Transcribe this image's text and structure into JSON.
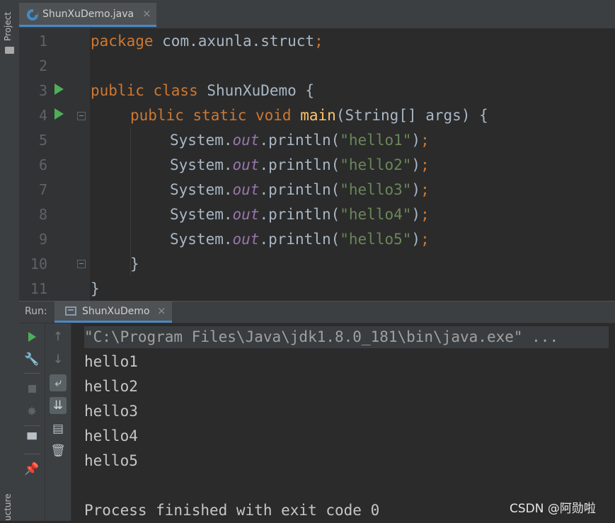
{
  "sidebar": {
    "project_label": "Project",
    "structure_label": "ucture"
  },
  "editor": {
    "tab_label": "ShunXuDemo.java",
    "close_glyph": "×",
    "line_numbers": [
      "1",
      "2",
      "3",
      "4",
      "5",
      "6",
      "7",
      "8",
      "9",
      "10",
      "11"
    ],
    "code": {
      "l1_kw": "package",
      "l1_rest": " com.axunla.struct",
      "l1_semi": ";",
      "l3_kw": "public class",
      "l3_rest": " ShunXuDemo {",
      "l4_kw": "public static void",
      "l4_fn": "main",
      "l4_rest": "(String[] args) {",
      "sys": "System.",
      "out": "out",
      "println": ".println(",
      "strings": [
        "\"hello1\"",
        "\"hello2\"",
        "\"hello3\"",
        "\"hello4\"",
        "\"hello5\""
      ],
      "close_paren": ")",
      "semi": ";",
      "l10": "}",
      "l11": "}"
    }
  },
  "run": {
    "label": "Run:",
    "tab_label": "ShunXuDemo",
    "close_glyph": "×",
    "command": "\"C:\\Program Files\\Java\\jdk1.8.0_181\\bin\\java.exe\" ...",
    "output_lines": [
      "hello1",
      "hello2",
      "hello3",
      "hello4",
      "hello5"
    ],
    "exit_message": "Process finished with exit code 0"
  },
  "watermark": "CSDN @阿勋啦",
  "colors": {
    "keyword": "#cc7832",
    "function": "#ffc66d",
    "string": "#6a8759",
    "field": "#9876aa",
    "run_green": "#4daf56",
    "accent_blue": "#4a88c7"
  }
}
